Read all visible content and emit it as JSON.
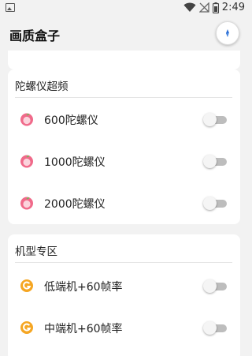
{
  "status_bar": {
    "time": "2:49",
    "icons": [
      "gallery-icon",
      "wifi-icon",
      "no-signal-icon",
      "battery-icon"
    ]
  },
  "app_bar": {
    "title": "画质盒子",
    "float_button_icon": "compass-icon"
  },
  "sections": [
    {
      "title": "陀螺仪超频",
      "items": [
        {
          "label": "600陀螺仪",
          "icon": "peach-icon",
          "enabled": false
        },
        {
          "label": "1000陀螺仪",
          "icon": "peach-icon",
          "enabled": false
        },
        {
          "label": "2000陀螺仪",
          "icon": "peach-icon",
          "enabled": false
        }
      ]
    },
    {
      "title": "机型专区",
      "items": [
        {
          "label": "低端机+60帧率",
          "icon": "g-badge-icon",
          "enabled": false
        },
        {
          "label": "中端机+60帧率",
          "icon": "g-badge-icon",
          "enabled": false
        }
      ]
    }
  ],
  "colors": {
    "background": "#f2f2f2",
    "card": "#ffffff",
    "toggle_off_track": "#bdbdbd",
    "peach": "#f06a8a",
    "g_badge": "#f5a623"
  }
}
